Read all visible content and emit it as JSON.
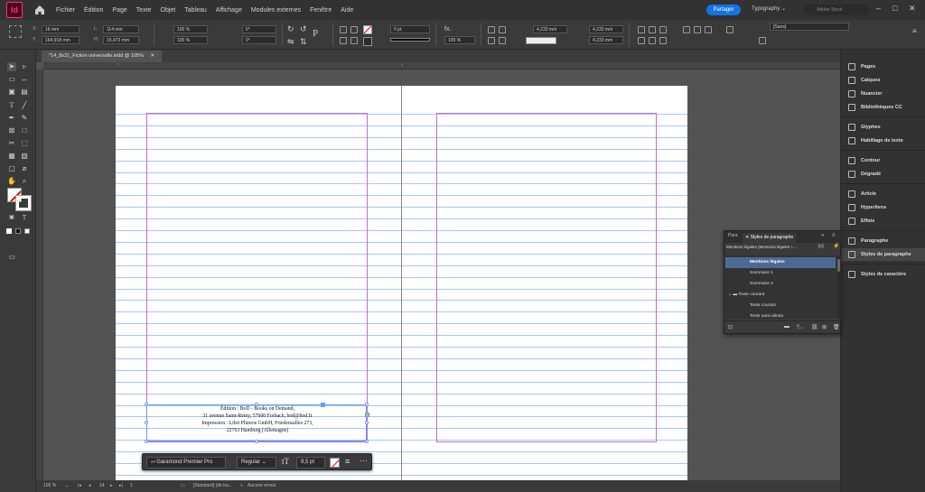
{
  "app": {
    "icon_text": "Id"
  },
  "menu": [
    "Fichier",
    "Édition",
    "Page",
    "Texte",
    "Objet",
    "Tableau",
    "Affichage",
    "Modules externes",
    "Fenêtre",
    "Aide"
  ],
  "header": {
    "share_label": "Partager",
    "workspace_label": "Typography",
    "stock_search_placeholder": "Adobe Stock"
  },
  "control": {
    "x": "16 mm",
    "y": "164,918 mm",
    "w": "114 mm",
    "h": "15,473 mm",
    "scale_x": "100 %",
    "scale_y": "100 %",
    "angle": "0°",
    "shear": "0°",
    "stroke_weight": "0 pt",
    "opacity": "100 %",
    "dim1": "4,233 mm",
    "dim2": "4,233 mm",
    "object_style": "[Sans]"
  },
  "document": {
    "tab_title": "*14_8x21_Fiction universelle.indd @ 105%"
  },
  "frame_text": [
    "Édition : BoD - Books on Demand,",
    "31 avenue Saint-Rémy, 57600 Forbach, bod@bod.fr",
    "Impression : Libri Plureos GmbH, Friedensallee 273,",
    "22763 Hamburg (Allemagne)"
  ],
  "context_bar": {
    "font": "Garamond Premier Pro",
    "style": "Regular",
    "size": "9,5 pt"
  },
  "status": {
    "zoom": "105 %",
    "page": "14",
    "total": "1",
    "page_style": "[Standard] (de tra...",
    "preflight": "Aucune erreur"
  },
  "dock": {
    "items": [
      "Pages",
      "Calques",
      "Nuancier",
      "Bibliothèques CC",
      "Glyphes",
      "Habillage de texte",
      "Contour",
      "Dégradé",
      "Article",
      "Hyperliens",
      "Effets",
      "Paragraphe",
      "Styles de paragraphe",
      "Styles de caractère"
    ]
  },
  "para_styles": {
    "tabs": [
      "Para",
      "Styles de paragraphe"
    ],
    "current": "Mentions légales (Mentions légales +...",
    "rows": [
      "Mentions légales",
      "Sommaire 1",
      "Sommaire 2",
      "Texte courant",
      "Texte courant",
      "Texte sans alinéa"
    ],
    "selected_index": 0
  },
  "colors": {
    "accent": "#1473e6",
    "baseline": "#a8c4ff",
    "margin": "#c36bd8",
    "frame": "#6699ff",
    "selected_row": "#4b6b94"
  }
}
